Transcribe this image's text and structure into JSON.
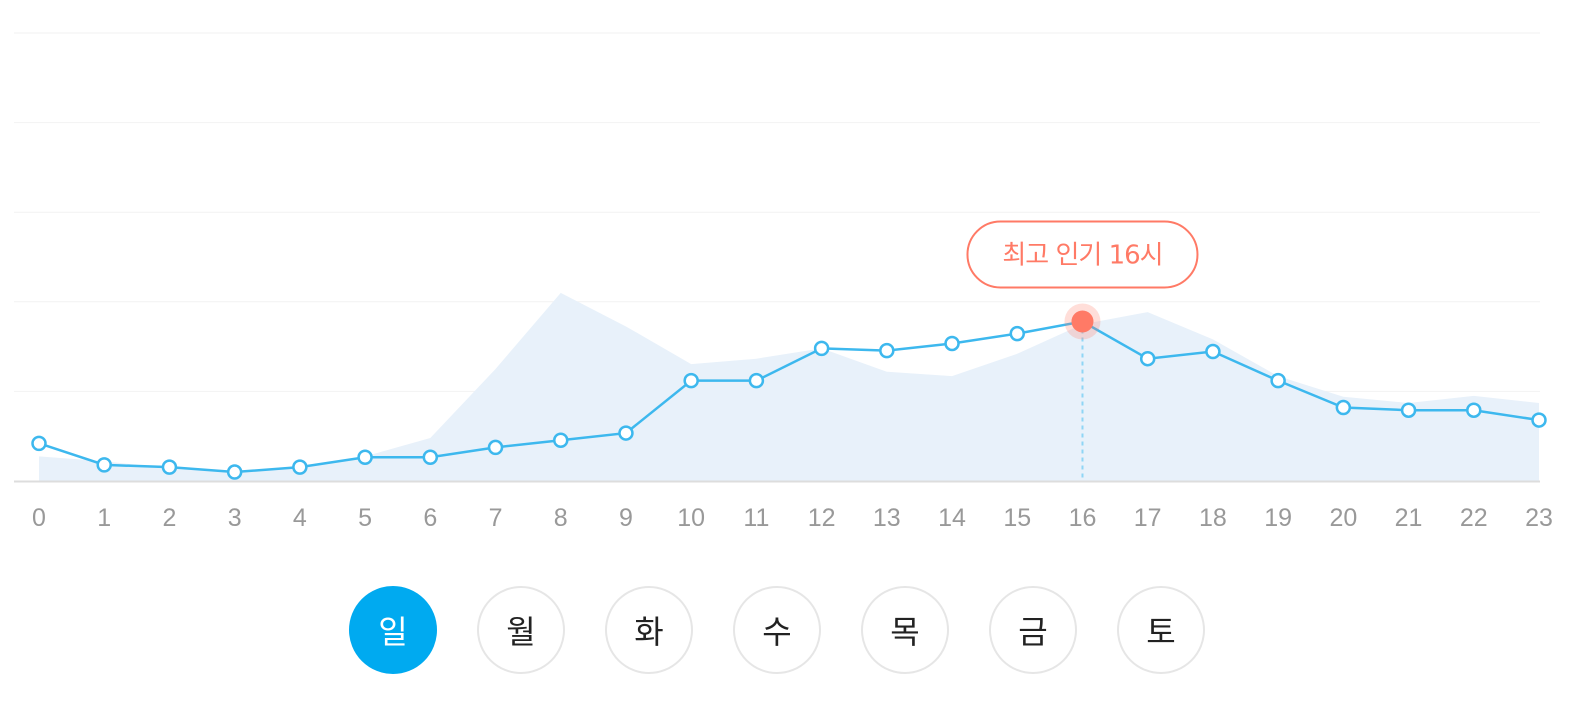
{
  "chart_data": {
    "type": "line",
    "x": [
      0,
      1,
      2,
      3,
      4,
      5,
      6,
      7,
      8,
      9,
      10,
      11,
      12,
      13,
      14,
      15,
      16,
      17,
      18,
      19,
      20,
      21,
      22,
      23
    ],
    "ylim": [
      0,
      100
    ],
    "grid": true,
    "series": [
      {
        "values": [
          8.4,
          3.6,
          3.1,
          2.0,
          3.1,
          5.3,
          5.3,
          7.5,
          9.1,
          10.7,
          22.4,
          22.4,
          29.6,
          29.1,
          30.7,
          32.9,
          35.6,
          27.3,
          28.9,
          22.4,
          16.4,
          15.8,
          15.8,
          13.6
        ],
        "color": "#3db8ee",
        "marker": "hollow-circle"
      },
      {
        "values": [
          5.5,
          4.4,
          2.8,
          2.0,
          3.1,
          5.5,
          9.6,
          25.0,
          42.0,
          34.5,
          26.1,
          27.3,
          29.6,
          24.4,
          23.4,
          28.4,
          35.0,
          37.7,
          31.6,
          23.4,
          18.8,
          17.4,
          19.0,
          17.4
        ],
        "color": "#e8f1fa",
        "type": "area"
      }
    ],
    "highlight": {
      "x": 16,
      "label": "최고 인기 16시",
      "color": "#ff7a66"
    }
  },
  "day_selector": {
    "items": [
      {
        "label": "일",
        "active": true
      },
      {
        "label": "월",
        "active": false
      },
      {
        "label": "화",
        "active": false
      },
      {
        "label": "수",
        "active": false
      },
      {
        "label": "목",
        "active": false
      },
      {
        "label": "금",
        "active": false
      },
      {
        "label": "토",
        "active": false
      }
    ],
    "active_color": "#00aaf0"
  }
}
